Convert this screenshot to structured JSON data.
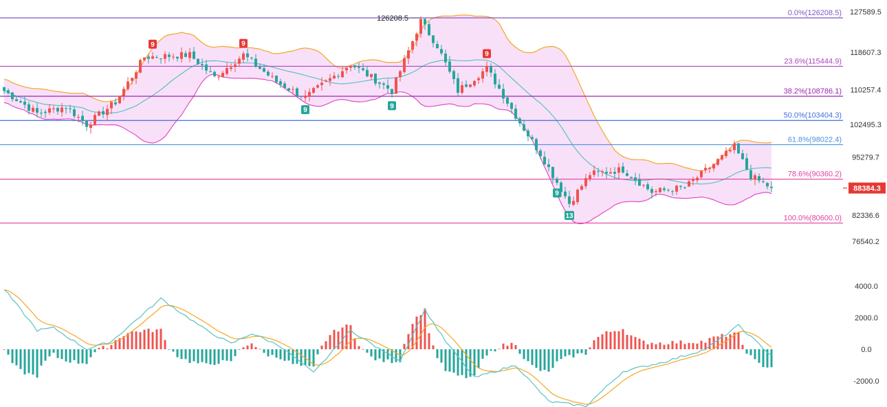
{
  "chart_data": [
    {
      "type": "candlestick",
      "price_axis": {
        "ticks": [
          "127589.5",
          "118607.3",
          "110257.4",
          "102495.3",
          "95279.7",
          "82336.6",
          "76540.2"
        ],
        "current_price_label": "88384.3",
        "current_price": 88384.3
      },
      "peak_annotation": {
        "label": "126208.5",
        "value": 126208.5
      },
      "fibonacci": {
        "levels": [
          {
            "label": "0.0%(126208.5)",
            "value": 126208.5,
            "color": "#7e57c2"
          },
          {
            "label": "23.6%(115444.9)",
            "value": 115444.9,
            "color": "#ab47bc"
          },
          {
            "label": "38.2%(108786.1)",
            "value": 108786.1,
            "color": "#9c27b0"
          },
          {
            "label": "50.0%(103404.3)",
            "value": 103404.3,
            "color": "#3f6fd8"
          },
          {
            "label": "61.8%(98022.4)",
            "value": 98022.4,
            "color": "#4a90e2"
          },
          {
            "label": "78.6%(90360.2)",
            "value": 90360.2,
            "color": "#e040a0"
          },
          {
            "label": "100.0%(80600.0)",
            "value": 80600.0,
            "color": "#e040a0"
          }
        ]
      },
      "td_sequential_labels": [
        {
          "text": "9",
          "kind": "sell",
          "candle_index": 36,
          "color": "#e53935"
        },
        {
          "text": "9",
          "kind": "sell",
          "candle_index": 58,
          "color": "#e53935"
        },
        {
          "text": "9",
          "kind": "sell",
          "candle_index": 117,
          "color": "#e53935"
        },
        {
          "text": "9",
          "kind": "buy",
          "candle_index": 73,
          "color": "#26a69a"
        },
        {
          "text": "9",
          "kind": "buy",
          "candle_index": 94,
          "color": "#26a69a"
        },
        {
          "text": "9",
          "kind": "buy",
          "candle_index": 134,
          "color": "#26a69a"
        },
        {
          "text": "13",
          "kind": "buy",
          "candle_index": 137,
          "color": "#26a69a"
        }
      ],
      "anchors": [
        {
          "i": 0,
          "p": 110000
        },
        {
          "i": 8,
          "p": 105000
        },
        {
          "i": 15,
          "p": 106500
        },
        {
          "i": 20,
          "p": 102500
        },
        {
          "i": 27,
          "p": 107500
        },
        {
          "i": 34,
          "p": 117500
        },
        {
          "i": 45,
          "p": 118000
        },
        {
          "i": 51,
          "p": 113000
        },
        {
          "i": 58,
          "p": 118000
        },
        {
          "i": 66,
          "p": 112000
        },
        {
          "i": 73,
          "p": 108500
        },
        {
          "i": 84,
          "p": 116000
        },
        {
          "i": 94,
          "p": 110000
        },
        {
          "i": 101,
          "p": 125500
        },
        {
          "i": 105,
          "p": 120000
        },
        {
          "i": 110,
          "p": 110000
        },
        {
          "i": 117,
          "p": 115000
        },
        {
          "i": 125,
          "p": 103000
        },
        {
          "i": 130,
          "p": 96000
        },
        {
          "i": 137,
          "p": 85000
        },
        {
          "i": 142,
          "p": 91500
        },
        {
          "i": 150,
          "p": 92500
        },
        {
          "i": 157,
          "p": 87500
        },
        {
          "i": 165,
          "p": 88500
        },
        {
          "i": 171,
          "p": 93000
        },
        {
          "i": 177,
          "p": 97500
        },
        {
          "i": 181,
          "p": 91000
        },
        {
          "i": 186,
          "p": 88400
        }
      ],
      "bollinger_color": "#f5a623",
      "bollinger_fill": "#f7d6f7",
      "middle_band_color": "#59c2c2",
      "up_color": "#ef5350",
      "down_color": "#26a69a"
    },
    {
      "type": "macd",
      "y_ticks": [
        "4000.0",
        "2000.0",
        "0.0",
        "-2000.0"
      ],
      "ylim": [
        -3500,
        4200
      ],
      "macd_anchors": [
        {
          "i": 0,
          "v": 3800
        },
        {
          "i": 8,
          "v": 1200
        },
        {
          "i": 12,
          "v": 1350
        },
        {
          "i": 20,
          "v": 0
        },
        {
          "i": 26,
          "v": 500
        },
        {
          "i": 38,
          "v": 3200
        },
        {
          "i": 49,
          "v": 1200
        },
        {
          "i": 55,
          "v": 350
        },
        {
          "i": 60,
          "v": 1000
        },
        {
          "i": 67,
          "v": 200
        },
        {
          "i": 75,
          "v": -1500
        },
        {
          "i": 84,
          "v": 1200
        },
        {
          "i": 91,
          "v": 0
        },
        {
          "i": 96,
          "v": -700
        },
        {
          "i": 102,
          "v": 2500
        },
        {
          "i": 107,
          "v": 500
        },
        {
          "i": 114,
          "v": -1800
        },
        {
          "i": 124,
          "v": -1000
        },
        {
          "i": 132,
          "v": -3300
        },
        {
          "i": 141,
          "v": -3600
        },
        {
          "i": 150,
          "v": -1400
        },
        {
          "i": 160,
          "v": -800
        },
        {
          "i": 170,
          "v": 0
        },
        {
          "i": 178,
          "v": 1500
        },
        {
          "i": 186,
          "v": -400
        }
      ],
      "signal_period": 6,
      "line_colors": {
        "macd": "#59c2c2",
        "signal": "#f5a623"
      },
      "hist_colors": {
        "positive": "#ef5350",
        "negative": "#26a69a"
      }
    }
  ]
}
